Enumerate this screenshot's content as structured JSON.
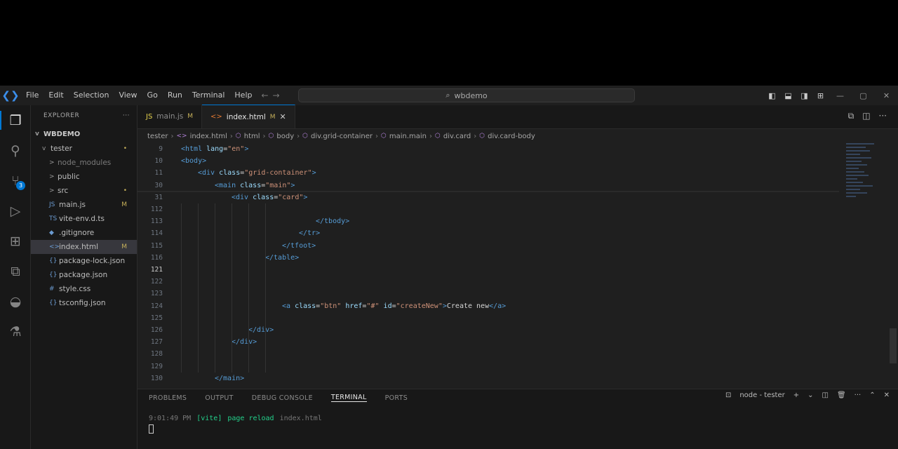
{
  "titlebar": {
    "menu": [
      "File",
      "Edit",
      "Selection",
      "View",
      "Go",
      "Run",
      "Terminal",
      "Help"
    ],
    "search_text": "wbdemo"
  },
  "sidebar": {
    "header": "EXPLORER",
    "root": "WBDEMO",
    "items": [
      {
        "label": "tester",
        "indent": 1,
        "chev": "v",
        "badge": "•"
      },
      {
        "label": "node_modules",
        "indent": 2,
        "chev": ">",
        "dim": true
      },
      {
        "label": "public",
        "indent": 2,
        "chev": ">"
      },
      {
        "label": "src",
        "indent": 2,
        "chev": ">",
        "badge": "•"
      },
      {
        "label": "main.js",
        "indent": 2,
        "icon": "JS",
        "badge": "M"
      },
      {
        "label": "vite-env.d.ts",
        "indent": 2,
        "icon": "TS"
      },
      {
        "label": ".gitignore",
        "indent": 2,
        "icon": "◆"
      },
      {
        "label": "index.html",
        "indent": 2,
        "icon": "<>",
        "badge": "M",
        "selected": true
      },
      {
        "label": "package-lock.json",
        "indent": 2,
        "icon": "{}"
      },
      {
        "label": "package.json",
        "indent": 2,
        "icon": "{}"
      },
      {
        "label": "style.css",
        "indent": 2,
        "icon": "#"
      },
      {
        "label": "tsconfig.json",
        "indent": 2,
        "icon": "{}"
      }
    ]
  },
  "editor": {
    "tabs": [
      {
        "label": "main.js",
        "mod": "M",
        "active": false
      },
      {
        "label": "index.html",
        "mod": "M",
        "active": true
      }
    ],
    "breadcrumb": [
      "tester",
      "index.html",
      "html",
      "body",
      "div.grid-container",
      "main.main",
      "div.card",
      "div.card-body"
    ],
    "code": [
      {
        "ln": "9",
        "indent": 0,
        "parts": [
          [
            "tag",
            "<html "
          ],
          [
            "attr",
            "lang"
          ],
          [
            "plain",
            "="
          ],
          [
            "str",
            "\"en\""
          ],
          [
            "tag",
            ">"
          ]
        ]
      },
      {
        "ln": "10",
        "indent": 0,
        "parts": [
          [
            "tag",
            "<body>"
          ]
        ]
      },
      {
        "ln": "11",
        "indent": 4,
        "parts": [
          [
            "tag",
            "<div "
          ],
          [
            "attr",
            "class"
          ],
          [
            "plain",
            "="
          ],
          [
            "str",
            "\"grid-container\""
          ],
          [
            "tag",
            ">"
          ]
        ]
      },
      {
        "ln": "30",
        "indent": 8,
        "parts": [
          [
            "tag",
            "<main "
          ],
          [
            "attr",
            "class"
          ],
          [
            "plain",
            "="
          ],
          [
            "str",
            "\"main\""
          ],
          [
            "tag",
            ">"
          ]
        ]
      },
      {
        "ln": "31",
        "indent": 12,
        "parts": [
          [
            "tag",
            "<div "
          ],
          [
            "attr",
            "class"
          ],
          [
            "plain",
            "="
          ],
          [
            "str",
            "\"card\""
          ],
          [
            "tag",
            ">"
          ]
        ]
      },
      {
        "ln": "112",
        "indent": 0,
        "parts": []
      },
      {
        "ln": "113",
        "indent": 32,
        "parts": [
          [
            "tag",
            "</tbody>"
          ]
        ]
      },
      {
        "ln": "114",
        "indent": 28,
        "parts": [
          [
            "tag",
            "</tr>"
          ]
        ]
      },
      {
        "ln": "115",
        "indent": 24,
        "parts": [
          [
            "tag",
            "</tfoot>"
          ]
        ]
      },
      {
        "ln": "116",
        "indent": 20,
        "parts": [
          [
            "tag",
            "</table>"
          ]
        ]
      },
      {
        "ln": "121",
        "indent": 20,
        "parts": [],
        "current": true
      },
      {
        "ln": "122",
        "indent": 0,
        "parts": []
      },
      {
        "ln": "123",
        "indent": 0,
        "parts": []
      },
      {
        "ln": "124",
        "indent": 24,
        "parts": [
          [
            "tag",
            "<a "
          ],
          [
            "attr",
            "class"
          ],
          [
            "plain",
            "="
          ],
          [
            "str",
            "\"btn\" "
          ],
          [
            "attr",
            "href"
          ],
          [
            "plain",
            "="
          ],
          [
            "str",
            "\"#\" "
          ],
          [
            "attr",
            "id"
          ],
          [
            "plain",
            "="
          ],
          [
            "str",
            "\"createNew\""
          ],
          [
            "tag",
            ">"
          ],
          [
            "plain",
            "Create new"
          ],
          [
            "tag",
            "</a>"
          ]
        ]
      },
      {
        "ln": "125",
        "indent": 0,
        "parts": []
      },
      {
        "ln": "126",
        "indent": 16,
        "parts": [
          [
            "tag",
            "</div>"
          ]
        ]
      },
      {
        "ln": "127",
        "indent": 12,
        "parts": [
          [
            "tag",
            "</div>"
          ]
        ]
      },
      {
        "ln": "128",
        "indent": 0,
        "parts": []
      },
      {
        "ln": "129",
        "indent": 0,
        "parts": []
      },
      {
        "ln": "130",
        "indent": 8,
        "parts": [
          [
            "tag",
            "</main>"
          ]
        ]
      }
    ]
  },
  "panel": {
    "tabs": [
      "PROBLEMS",
      "OUTPUT",
      "DEBUG CONSOLE",
      "TERMINAL",
      "PORTS"
    ],
    "active_tab": "TERMINAL",
    "shell": "node - tester",
    "terminal": {
      "time": "9:01:49 PM",
      "tag": "[vite]",
      "message": "page reload",
      "file": "index.html"
    }
  },
  "colors": {
    "accent": "#0078d4",
    "modified": "#c6b05a",
    "tag": "#569cd6",
    "attr": "#9cdcfe",
    "string": "#ce9178"
  }
}
